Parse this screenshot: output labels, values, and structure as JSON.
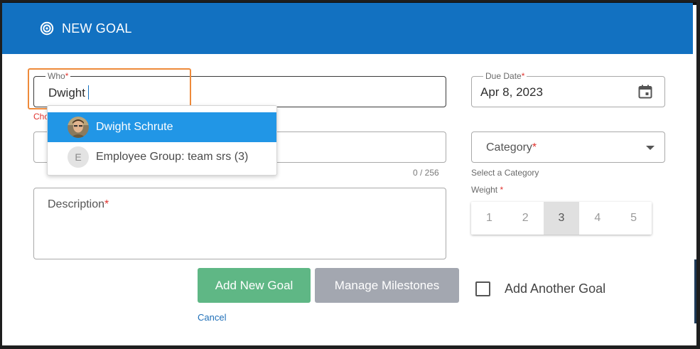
{
  "header": {
    "title": "NEW GOAL",
    "icon": "target-icon",
    "color": "#1271c1"
  },
  "who": {
    "label": "Who",
    "value": "Dwight",
    "helper": "Cho"
  },
  "dropdown": {
    "options": [
      {
        "label": "Dwight Schrute",
        "avatar": "person-avatar",
        "selected": true
      },
      {
        "letter": "E",
        "label": "Employee Group: team srs (3)",
        "selected": false
      }
    ]
  },
  "goal_title": {
    "counter": "0 / 256"
  },
  "description": {
    "label": "Description"
  },
  "due_date": {
    "label": "Due Date",
    "value": "Apr 8, 2023",
    "icon": "calendar-icon"
  },
  "category": {
    "label": "Category",
    "helper": "Select a Category",
    "icon": "chevron-down-icon"
  },
  "weight": {
    "label": "Weight",
    "options": [
      "1",
      "2",
      "3",
      "4",
      "5"
    ],
    "selected": "3"
  },
  "buttons": {
    "add_goal": "Add New Goal",
    "manage_milestones": "Manage Milestones",
    "cancel": "Cancel",
    "add_goal_color": "#5fb785",
    "manage_color": "#a3a7b0"
  },
  "add_another": {
    "label": "Add Another Goal",
    "checked": false
  },
  "required_mark": "*"
}
